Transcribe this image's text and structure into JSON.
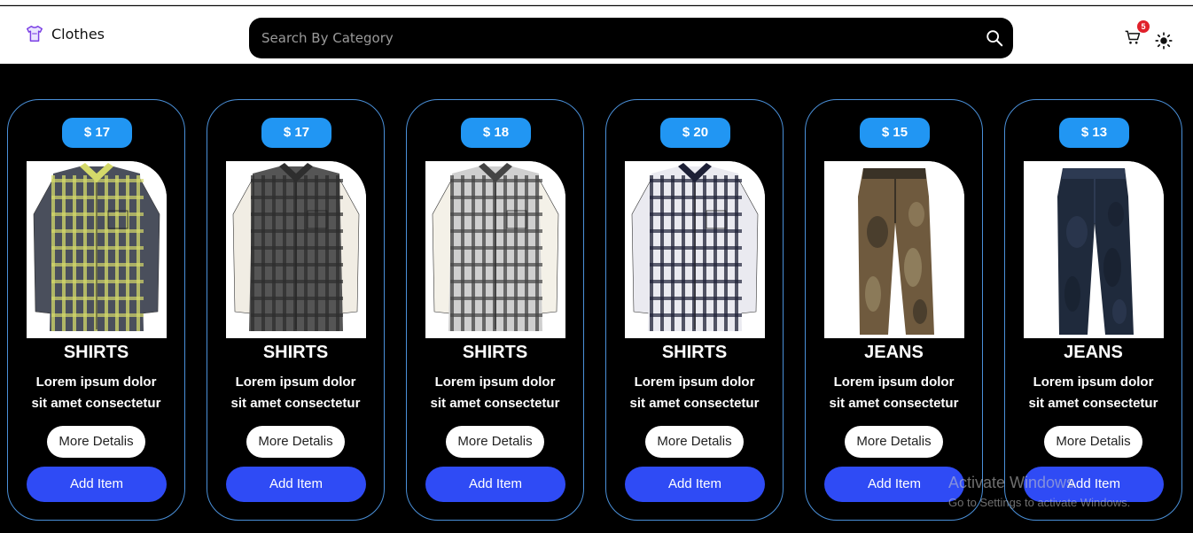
{
  "header": {
    "brand": "Clothes",
    "search_placeholder": "Search By Category",
    "cart_count": "5"
  },
  "products": [
    {
      "price": "$ 17",
      "category": "SHIRTS",
      "desc1": "Lorem ipsum dolor",
      "desc2": "sit amet consectetur",
      "more": "More Detalis",
      "add": "Add Item",
      "kind": "shirt",
      "colors": [
        "#4a4f5c",
        "#d4d96a",
        "#e8e8e8"
      ]
    },
    {
      "price": "$ 17",
      "category": "SHIRTS",
      "desc1": "Lorem ipsum dolor",
      "desc2": "sit amet consectetur",
      "more": "More Detalis",
      "add": "Add Item",
      "kind": "shirt-layered",
      "colors": [
        "#555555",
        "#2e2e2e",
        "#f1ede4"
      ]
    },
    {
      "price": "$ 18",
      "category": "SHIRTS",
      "desc1": "Lorem ipsum dolor",
      "desc2": "sit amet consectetur",
      "more": "More Detalis",
      "add": "Add Item",
      "kind": "shirt-layered",
      "colors": [
        "#cfcfcf",
        "#444444",
        "#f4f1e8"
      ]
    },
    {
      "price": "$ 20",
      "category": "SHIRTS",
      "desc1": "Lorem ipsum dolor",
      "desc2": "sit amet consectetur",
      "more": "More Detalis",
      "add": "Add Item",
      "kind": "shirt",
      "colors": [
        "#eaeaf0",
        "#1d2036",
        "#ffffff"
      ]
    },
    {
      "price": "$ 15",
      "category": "JEANS",
      "desc1": "Lorem ipsum dolor",
      "desc2": "sit amet consectetur",
      "more": "More Detalis",
      "add": "Add Item",
      "kind": "pants",
      "colors": [
        "#6f5a3e",
        "#3a3226",
        "#a89a74"
      ]
    },
    {
      "price": "$ 13",
      "category": "JEANS",
      "desc1": "Lorem ipsum dolor",
      "desc2": "sit amet consectetur",
      "more": "More Detalis",
      "add": "Add Item",
      "kind": "pants",
      "colors": [
        "#1f2a3c",
        "#2d3a52",
        "#141b28"
      ]
    }
  ],
  "watermark": {
    "line1": "Activate Windows",
    "line2": "Go to Settings to activate Windows."
  },
  "icons": {
    "brand": "tshirt-icon",
    "search": "search-icon",
    "cart": "cart-icon",
    "theme": "sun-icon"
  }
}
